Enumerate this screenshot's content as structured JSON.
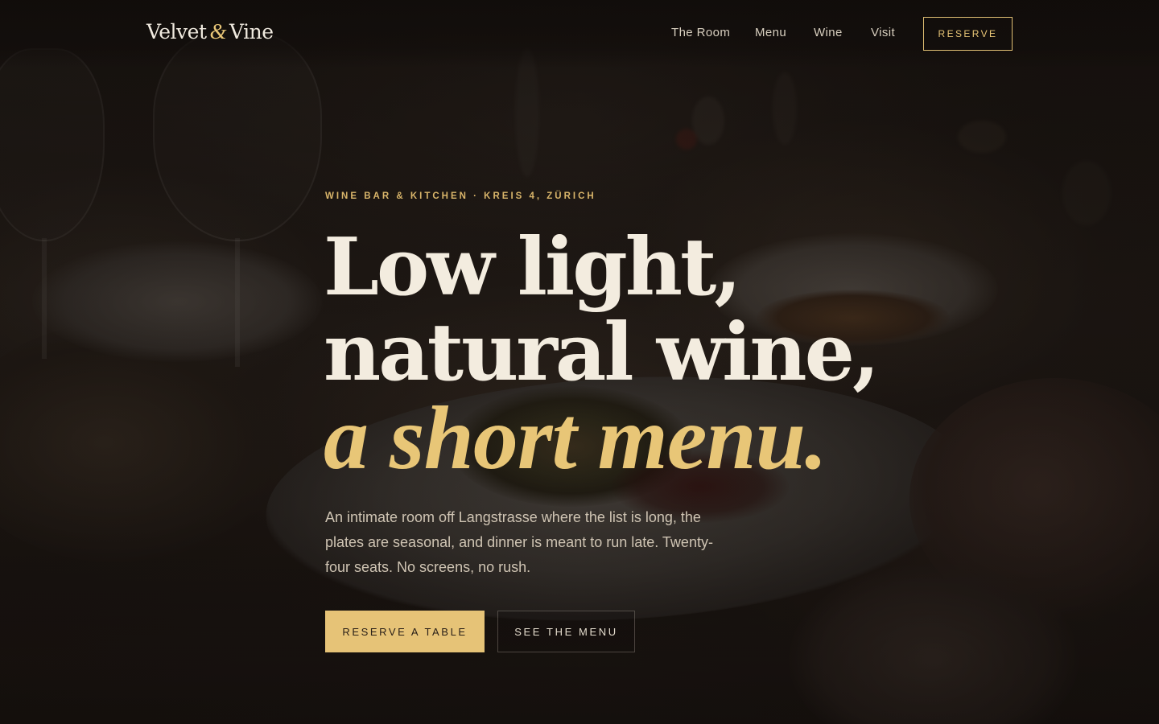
{
  "brand": {
    "name_part1": "Velvet",
    "ampersand": "&",
    "name_part2": "Vine"
  },
  "nav": {
    "links": [
      "The Room",
      "Menu",
      "Wine",
      "Visit"
    ],
    "reserve_label": "RESERVE"
  },
  "hero": {
    "eyebrow": "WINE BAR & KITCHEN · KREIS 4, ZÜRICH",
    "headline_line1": "Low light,",
    "headline_line2": "natural wine,",
    "headline_line3": "a short menu.",
    "lede": "An intimate room off Langstrasse where the list is long, the plates are seasonal, and dinner is meant to run late. Twenty-four seats. No screens, no rush.",
    "primary_cta": "RESERVE A TABLE",
    "secondary_cta": "SEE THE MENU"
  },
  "colors": {
    "accent_gold": "#e8c677",
    "background": "#140f0c",
    "text_cream": "#f3ecdf"
  }
}
